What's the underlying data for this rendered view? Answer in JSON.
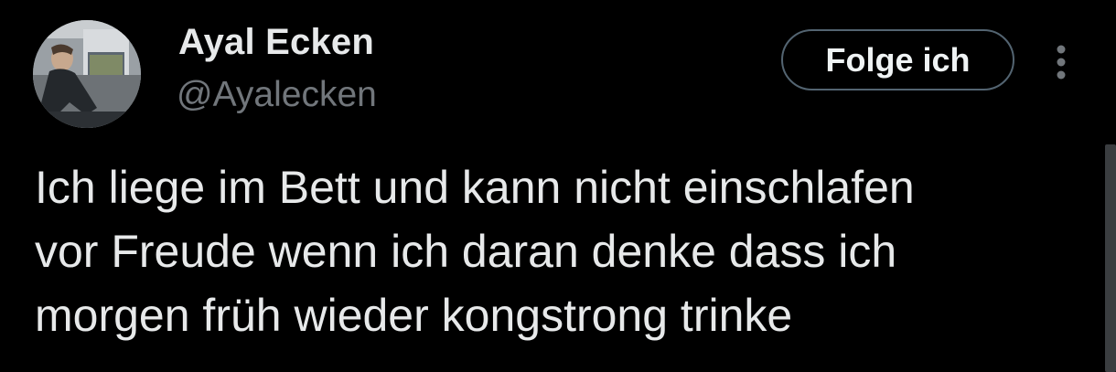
{
  "author": {
    "display_name": "Ayal Ecken",
    "handle": "@Ayalecken"
  },
  "actions": {
    "follow_label": "Folge ich",
    "more_icon": "more-vertical-icon"
  },
  "tweet": {
    "lines": [
      "Ich liege im Bett und kann nicht einschlafen",
      "vor Freude wenn ich daran denke dass ich",
      "morgen früh wieder kongstrong trinke"
    ]
  },
  "colors": {
    "background": "#000000",
    "primary_text": "#e7e9ea",
    "secondary_text": "#71767b",
    "button_border": "#536471"
  }
}
